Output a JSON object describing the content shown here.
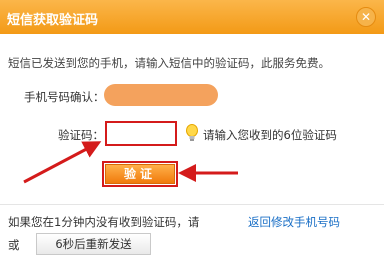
{
  "dialog": {
    "title": "短信获取验证码",
    "close_icon": "close-icon"
  },
  "intro_text": "短信已发送到您的手机，请输入短信中的验证码，此服务免费。",
  "phone": {
    "label": "手机号码确认："
  },
  "code": {
    "label": "验证码：",
    "value": "",
    "hint": "请输入您收到的6位验证码",
    "hint_icon": "lightbulb-icon"
  },
  "verify_button": "验证",
  "footer": {
    "not_received": "如果您在1分钟内没有收到验证码，请",
    "back_link": "返回修改手机号码",
    "or": "或",
    "resend_button": "6秒后重新发送"
  },
  "colors": {
    "title_bar": "#f5a623",
    "verify_button": "#f28a1a",
    "annotation_red": "#d41b1b",
    "link": "#1a6fc6",
    "masked_phone": "#f4a25d"
  }
}
